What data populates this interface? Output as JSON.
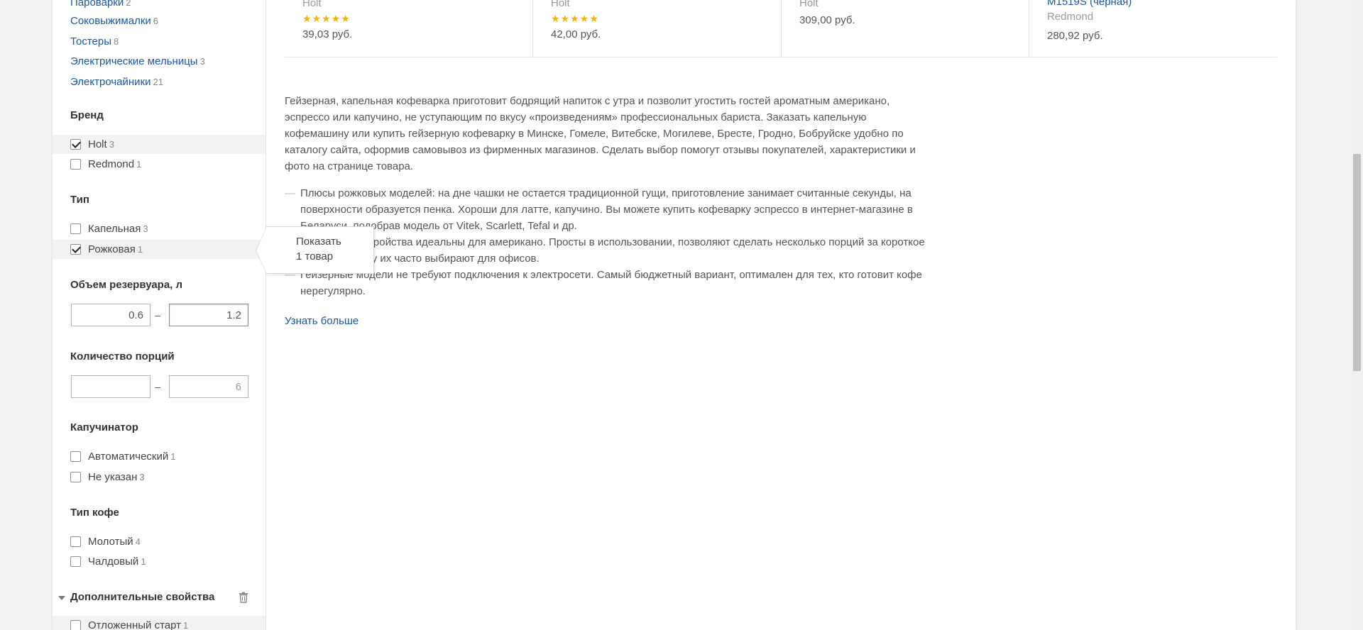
{
  "sidebar": {
    "categories": [
      {
        "label": "Пароварки",
        "count": "2"
      },
      {
        "label": "Соковыжималки",
        "count": "6"
      },
      {
        "label": "Тостеры",
        "count": "8"
      },
      {
        "label": "Электрические мельницы",
        "count": "3"
      },
      {
        "label": "Электрочайники",
        "count": "21"
      }
    ],
    "brand": {
      "title": "Бренд",
      "options": [
        {
          "label": "Holt",
          "count": "3",
          "checked": true
        },
        {
          "label": "Redmond",
          "count": "1",
          "checked": false
        }
      ]
    },
    "type": {
      "title": "Тип",
      "options": [
        {
          "label": "Капельная",
          "count": "3",
          "checked": false
        },
        {
          "label": "Рожковая",
          "count": "1",
          "checked": true
        }
      ]
    },
    "volume": {
      "title": "Объем резервуара, л",
      "from_value": "0.6",
      "to_value": "1.2",
      "separator": "–"
    },
    "portions": {
      "title": "Количество порций",
      "from_value": "",
      "to_placeholder": "6",
      "separator": "–"
    },
    "cappuccinator": {
      "title": "Капучинатор",
      "options": [
        {
          "label": "Автоматический",
          "count": "1",
          "checked": false
        },
        {
          "label": "Не указан",
          "count": "3",
          "checked": false
        }
      ]
    },
    "coffee_type": {
      "title": "Тип кофе",
      "options": [
        {
          "label": "Молотый",
          "count": "4",
          "checked": false
        },
        {
          "label": "Чалдовый",
          "count": "1",
          "checked": false
        }
      ]
    },
    "extra": {
      "title": "Дополнительные свойства",
      "options": [
        {
          "label": "Отложенный старт",
          "count": "1",
          "checked": false
        }
      ]
    }
  },
  "products": [
    {
      "brand": "Holt",
      "stars": "★★★★★",
      "price": "39,03 руб."
    },
    {
      "brand": "Holt",
      "stars": "★★★★★",
      "price": "42,00 руб."
    },
    {
      "brand": "Holt",
      "price": "309,00 руб."
    },
    {
      "name": "M1519S (черная)",
      "brand": "Redmond",
      "price": "280,92 руб."
    }
  ],
  "seo": {
    "paragraph_lines": [
      "Гейзерная, капельная кофеварка приготовит бодрящий напиток с утра и позволит угостить гостей ароматным американо,",
      "эспрессо или капучино, не уступающим по вкусу «произведениям» профессиональных бариста. Заказать капельную",
      "кофемашину или купить гейзерную кофеварку в Минске, Гомеле, Витебске, Могилеве, Бресте, Гродно, Бобруйске удобно по",
      "каталогу сайта, оформив самовывоз из фирменных магазинов. Сделать выбор помогут отзывы покупателей, характеристики и",
      "фото на странице товара."
    ],
    "bullet_dash": "—",
    "bullets": [
      [
        "Плюсы рожковых моделей: на дне чашки не остается традиционной гущи, приготовление занимает считанные секунды, на",
        "поверхности образуется пенка. Хороши для латте, капучино. Вы можете купить кофеварку эспрессо в интернет-магазине в",
        "Беларуси, подобрав модель от Vitek, Scarlett, Tefal и др."
      ],
      [
        "Капельные устройства идеальны для американо. Просты в использовании, позволяют сделать несколько порций за короткое",
        "время, поэтому их часто выбирают для офисов."
      ],
      [
        "Гейзерные модели не требуют подключения к электросети. Самый бюджетный вариант, оптимален для тех, кто готовит кофе",
        "нерегулярно."
      ]
    ],
    "more_link": "Узнать больше"
  },
  "popup": {
    "line1": "Показать",
    "line2": "1 товар"
  },
  "colors": {
    "link": "#1a57a8",
    "star": "#f5b400",
    "text": "#555555"
  }
}
